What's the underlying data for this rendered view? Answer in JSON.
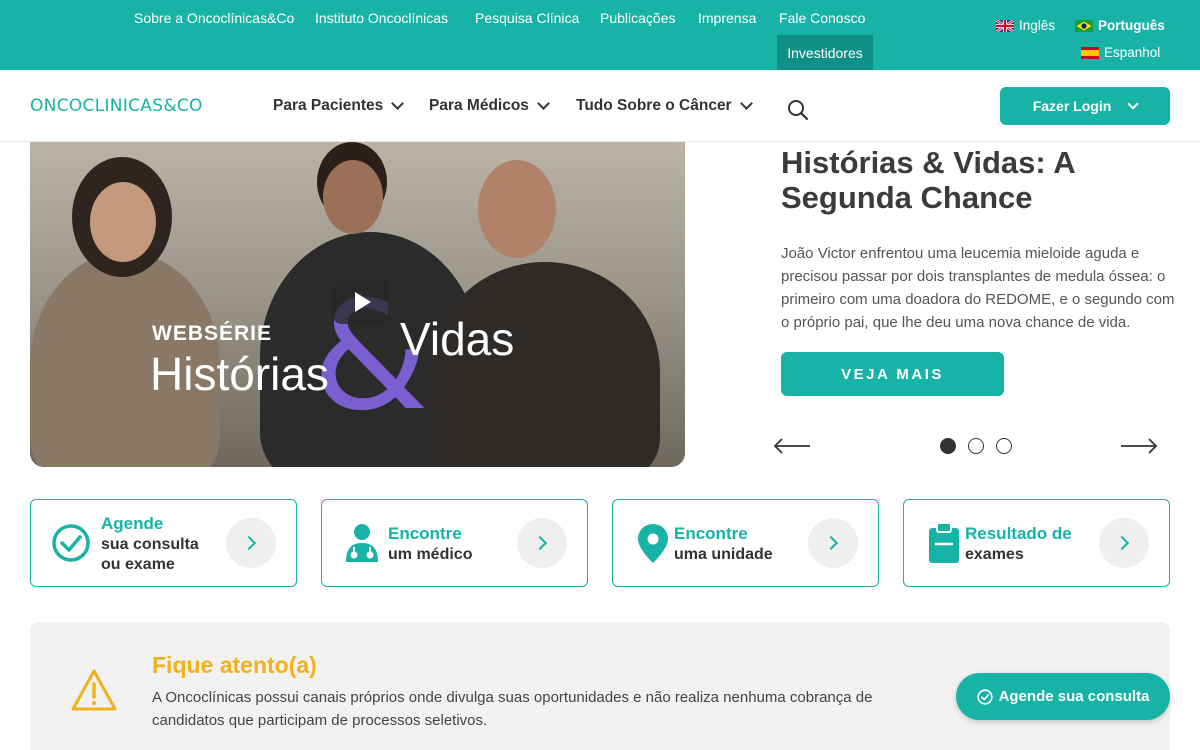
{
  "topbar": {
    "links": [
      "Sobre a Oncoclínicas&Co",
      "Instituto Oncoclínicas",
      "Pesquisa Clínica",
      "Publicações",
      "Imprensa",
      "Fale Conosco"
    ],
    "investors": "Investidores",
    "languages": [
      {
        "label": "Inglês",
        "active": false
      },
      {
        "label": "Português",
        "active": true
      },
      {
        "label": "Espanhol",
        "active": false
      }
    ]
  },
  "nav": {
    "logo": "ONCOCLINICAS&CO",
    "items": [
      "Para Pacientes",
      "Para Médicos",
      "Tudo Sobre o Câncer"
    ],
    "login": "Fazer Login"
  },
  "hero": {
    "video": {
      "series_label": "WEBSÉRIE",
      "title_left": "Histórias",
      "title_amp": "&",
      "title_right": "Vidas"
    },
    "title": "Histórias & Vidas: A Segunda Chance",
    "text": "João Victor enfrentou uma leucemia mieloide aguda e precisou passar por dois transplantes de medula óssea: o primeiro com uma doadora do REDOME, e o segundo com o próprio pai, que lhe deu uma nova chance de vida.",
    "cta": "VEJA MAIS",
    "slides": 3,
    "active_slide": 1
  },
  "cards": [
    {
      "line1": "Agende",
      "line2": "sua consulta",
      "line3": "ou exame",
      "icon": "check-circle-icon"
    },
    {
      "line1": "Encontre",
      "line2": "um médico",
      "icon": "doctor-icon"
    },
    {
      "line1": "Encontre",
      "line2": "uma unidade",
      "icon": "location-pin-icon"
    },
    {
      "line1": "Resultado de",
      "line2": "exames",
      "icon": "clipboard-icon"
    }
  ],
  "notice": {
    "title": "Fique atento(a)",
    "text": "A Oncoclínicas possui canais próprios onde divulga suas oportunidades e não realiza nenhuma cobrança de candidatos que participam de processos seletivos."
  },
  "floating": {
    "label": "Agende sua consulta"
  },
  "colors": {
    "primary": "#17b3a6",
    "primary_dark": "#0f8f85",
    "warning": "#f2b21b",
    "text": "#333333"
  }
}
